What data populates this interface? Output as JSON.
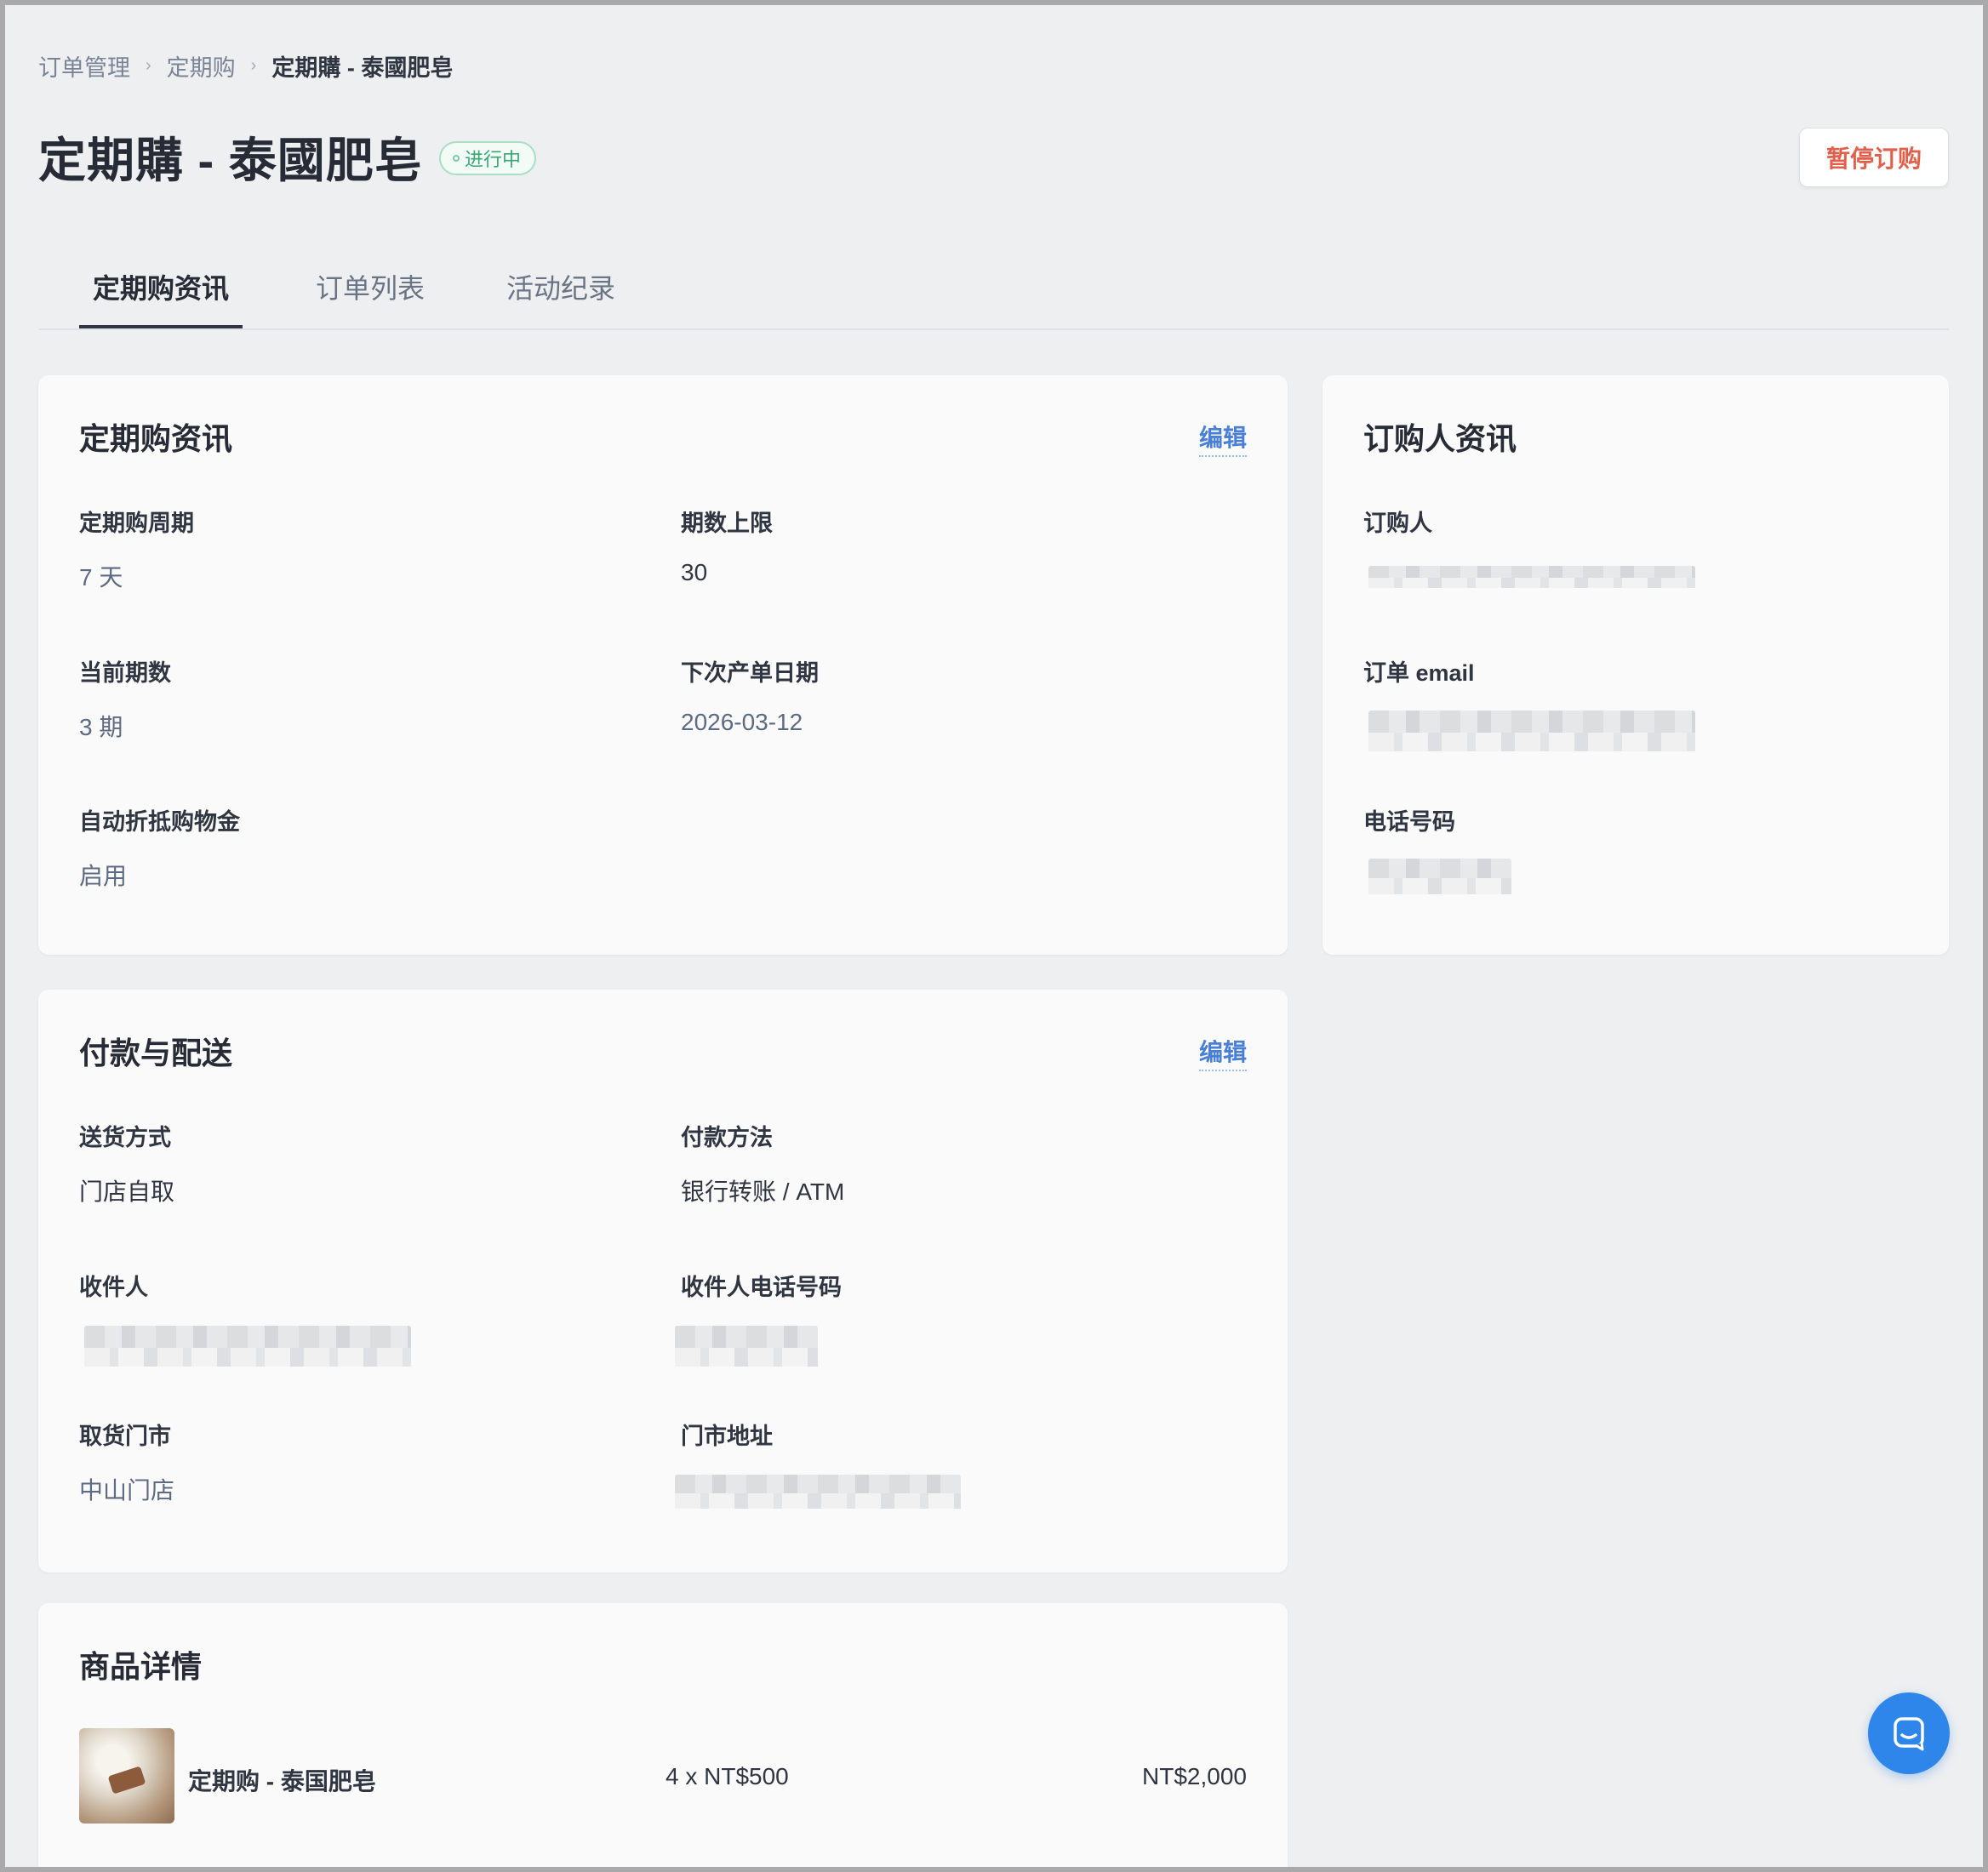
{
  "breadcrumb": [
    "订单管理",
    "定期购",
    "定期購 - 泰國肥皂"
  ],
  "header": {
    "title": "定期購 - 泰國肥皂",
    "status": "进行中",
    "pause_label": "暂停订购"
  },
  "tabs": [
    "定期购资讯",
    "订单列表",
    "活动纪录"
  ],
  "subscription_info": {
    "title": "定期购资讯",
    "edit_label": "编辑",
    "cycle_label": "定期购周期",
    "cycle_value": "7 天",
    "limit_label": "期数上限",
    "limit_value": "30",
    "current_label": "当前期数",
    "current_value": "3 期",
    "next_date_label": "下次产单日期",
    "next_date_value": "2026-03-12",
    "auto_credit_label": "自动折抵购物金",
    "auto_credit_value": "启用"
  },
  "customer_info": {
    "title": "订购人资讯",
    "name_label": "订购人",
    "email_label": "订单 email",
    "phone_label": "电话号码"
  },
  "payment_delivery": {
    "title": "付款与配送",
    "edit_label": "编辑",
    "delivery_label": "送货方式",
    "delivery_value": "门店自取",
    "payment_label": "付款方法",
    "payment_value": "银行转账 / ATM",
    "recipient_label": "收件人",
    "recipient_phone_label": "收件人电话号码",
    "pickup_store_label": "取货门市",
    "pickup_store_value": "中山门店",
    "store_address_label": "门市地址"
  },
  "product_details": {
    "title": "商品详情",
    "items": [
      {
        "name": "定期购 - 泰国肥皂",
        "qty_price": "4 x NT$500",
        "total": "NT$2,000"
      }
    ]
  },
  "icons": {
    "breadcrumb_separator": "chevron-right-icon",
    "chat": "chat-icon"
  },
  "colors": {
    "accent_link": "#4a7fd6",
    "danger": "#e0604b",
    "status_green": "#39a776",
    "chat_button": "#2f86ea"
  }
}
